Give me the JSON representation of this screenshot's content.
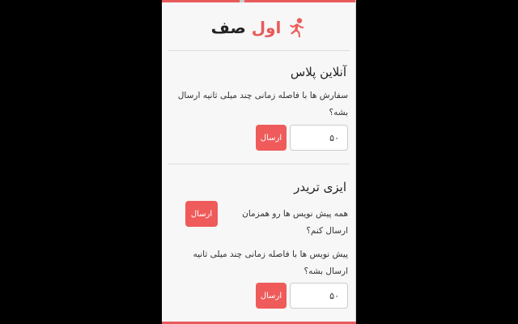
{
  "app": {
    "brand_part1": "اول",
    "brand_part2": "صف",
    "logo_icon": "running-person-icon",
    "accent_color": "#ef5b5b"
  },
  "online_plus": {
    "title": "آنلاین پلاس",
    "description": "سفارش ها با فاصله زمانی چند میلی ثانیه ارسال بشه؟",
    "delay_value": "۵۰",
    "send_label": "ارسال"
  },
  "easy_trader": {
    "title": "ایزی تریدر",
    "simultaneous_question": "همه پیش نویس ها رو همزمان ارسال کنم؟",
    "simultaneous_send_label": "ارسال",
    "delay_question": "پیش نویس ها با فاصله زمانی چند میلی ثانیه ارسال بشه؟",
    "delay_value": "۵۰",
    "send_label": "ارسال"
  }
}
